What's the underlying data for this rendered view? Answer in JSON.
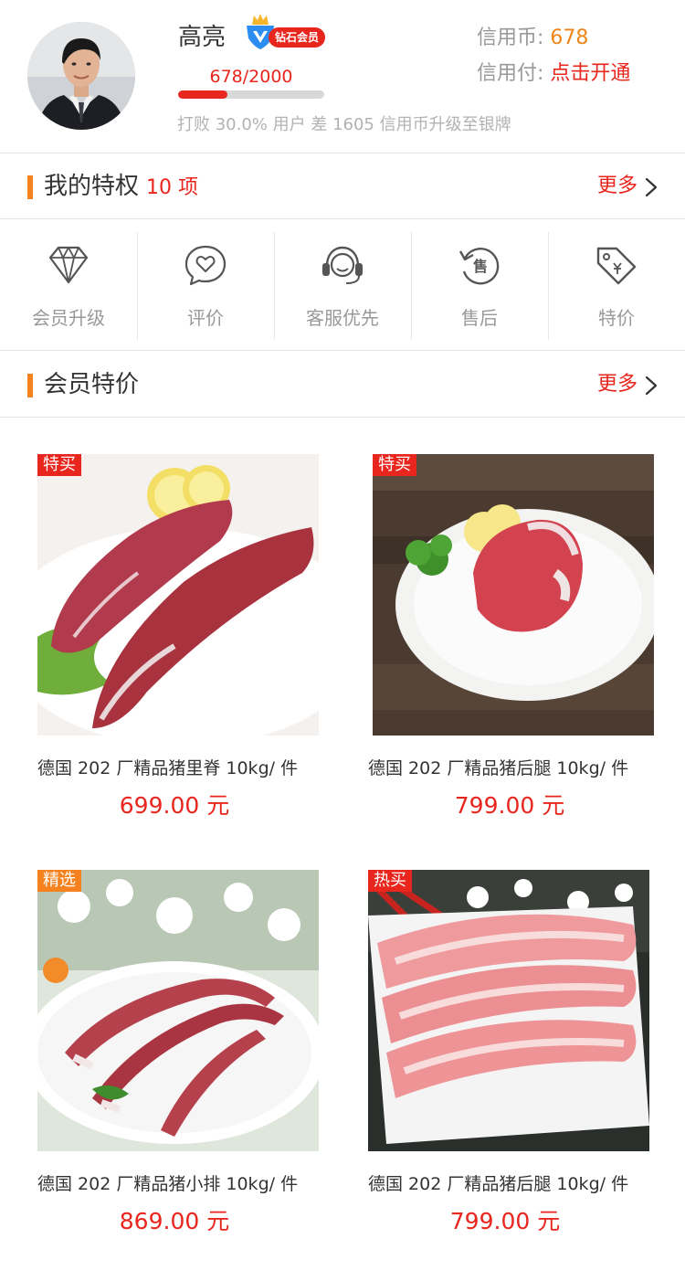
{
  "profile": {
    "name": "高亮",
    "vip_badge": "钻石会员",
    "progress_text": "678/2000",
    "progress_ratio": 0.339,
    "rank_note": "打败 30.0% 用户 差 1605 信用币升级至银牌",
    "credit_coin_label": "信用币:",
    "credit_coin_value": "678",
    "credit_pay_label": "信用付:",
    "credit_pay_value": "点击开通"
  },
  "privileges_section": {
    "title": "我的特权",
    "count": "10 项",
    "more": "更多"
  },
  "privileges": [
    {
      "label": "会员升级",
      "icon": "diamond-icon"
    },
    {
      "label": "评价",
      "icon": "heart-chat-icon"
    },
    {
      "label": "客服优先",
      "icon": "headset-icon"
    },
    {
      "label": "售后",
      "icon": "after-sale-icon"
    },
    {
      "label": "特价",
      "icon": "price-tag-icon"
    }
  ],
  "deals_section": {
    "title": "会员特价",
    "more": "更多"
  },
  "products": [
    {
      "tag": "特买",
      "name": "德国 202 厂精品猪里脊 10kg/ 件",
      "price": "699.00 元"
    },
    {
      "tag": "特买",
      "name": "德国 202 厂精品猪后腿 10kg/ 件",
      "price": "799.00 元"
    },
    {
      "tag": "精选",
      "name": "德国 202 厂精品猪小排 10kg/ 件",
      "price": "869.00 元"
    },
    {
      "tag": "热买",
      "name": "德国 202 厂精品猪后腿 10kg/ 件",
      "price": "799.00 元"
    }
  ],
  "colors": {
    "accent_red": "#e8261e",
    "accent_orange": "#f5821f",
    "coin_orange": "#f08519",
    "muted_text": "#999999"
  }
}
